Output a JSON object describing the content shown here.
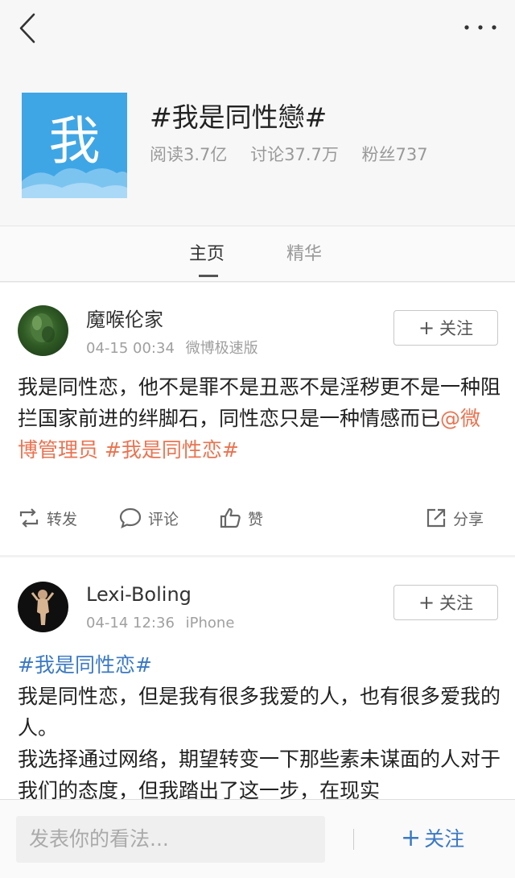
{
  "nav": {
    "back_icon": "chevron-left-icon",
    "more_icon": "more-dots-icon"
  },
  "topic": {
    "avatar_char": "我",
    "avatar_color": "#3fa6e6",
    "title": "#我是同性戀#",
    "stats": {
      "reads": "阅读3.7亿",
      "discussions": "讨论37.7万",
      "fans": "粉丝737"
    }
  },
  "tabs": [
    {
      "label": "主页",
      "active": true
    },
    {
      "label": "精华",
      "active": false
    }
  ],
  "posts": [
    {
      "username": "魔喉伦家",
      "time": "04-15 00:34",
      "source": "微博极速版",
      "follow_plus": "+",
      "follow_label": "关注",
      "text_main": "我是同性恋，他不是罪不是丑恶不是淫秽更不是一种阻拦国家前进的绊脚石，同性恋只是一种情感而已",
      "mention": "@微博管理员",
      "hashtag": " #我是同性恋#",
      "actions": {
        "repost": "转发",
        "comment": "评论",
        "like": "赞",
        "share": "分享"
      }
    },
    {
      "username": "Lexi-Boling",
      "time": "04-14 12:36",
      "source": "iPhone",
      "follow_plus": "+",
      "follow_label": "关注",
      "hashtag": "#我是同性恋#",
      "line1": "我是同性恋，但是我有很多我爱的人，也有很多爱我的人。",
      "line2": "我选择通过网络，期望转变一下那些素未谋面的人对于我们的态度，但我踏出了这一步，在现实"
    }
  ],
  "bottom_bar": {
    "input_placeholder": "发表你的看法...",
    "follow_plus": "+",
    "follow_label": "关注"
  },
  "colors": {
    "link_orange": "#eb7350",
    "link_blue": "#3a79c5",
    "page_bg": "#f2f2f2"
  }
}
